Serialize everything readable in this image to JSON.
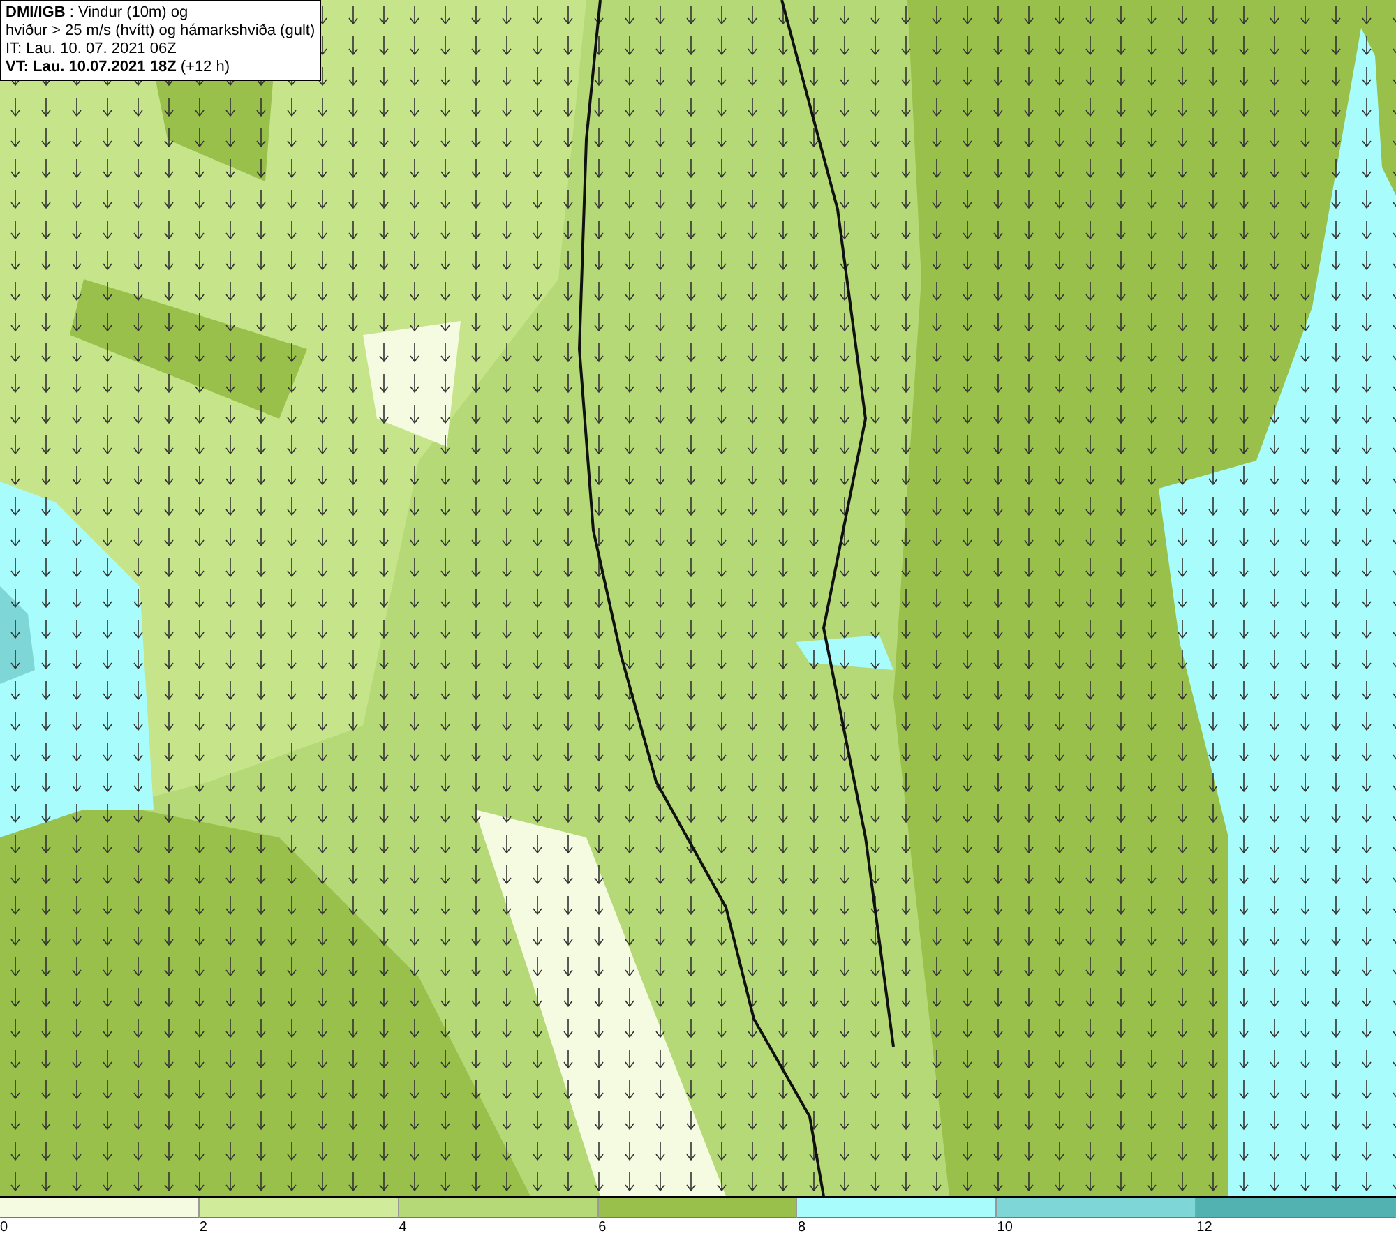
{
  "header": {
    "lines": [
      "**DMI/IGB** : Vindur (10m) og",
      "hviður > 25 m/s (hvítt) og hámarkshviða (gult)",
      "IT: Lau. 10. 07. 2021 06Z",
      "**VT: Lau. 10.07.2021 18Z** (+12 h)"
    ]
  },
  "legend": [
    {
      "label": "0",
      "color": "#f4fbe0"
    },
    {
      "label": "2",
      "color": "#d0ec9a"
    },
    {
      "label": "4",
      "color": "#b5d977"
    },
    {
      "label": "6",
      "color": "#98c04a"
    },
    {
      "label": "8",
      "color": "#a8fcfc"
    },
    {
      "label": "10",
      "color": "#7ed6d6"
    },
    {
      "label": "12",
      "color": "#52b2b2"
    }
  ]
}
